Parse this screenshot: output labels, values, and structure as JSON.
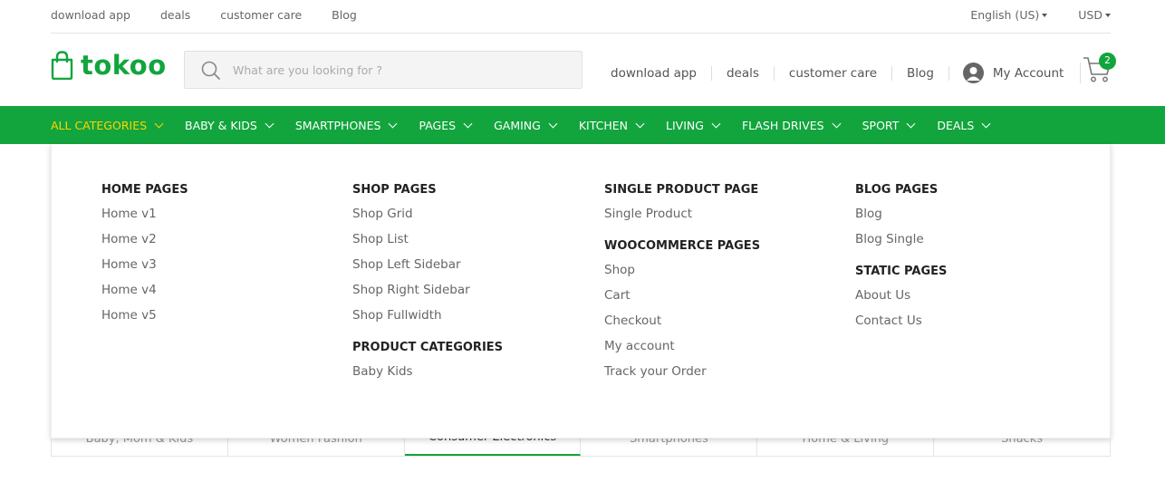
{
  "topbar": {
    "links": [
      "download app",
      "deals",
      "customer care",
      "Blog"
    ],
    "language": "English (US)",
    "currency": "USD"
  },
  "header": {
    "logo_text": "tokoo",
    "search_placeholder": "What are you looking for ?",
    "links": [
      "download app",
      "deals",
      "customer care",
      "Blog"
    ],
    "account_label": "My Account",
    "cart_count": "2"
  },
  "nav": {
    "items": [
      {
        "label": "ALL CATEGORIES",
        "active": true
      },
      {
        "label": "BABY & KIDS"
      },
      {
        "label": "SMARTPHONES"
      },
      {
        "label": "PAGES"
      },
      {
        "label": "GAMING"
      },
      {
        "label": "KITCHEN"
      },
      {
        "label": "LIVING"
      },
      {
        "label": "FLASH DRIVES"
      },
      {
        "label": "SPORT"
      },
      {
        "label": "DEALS"
      }
    ]
  },
  "mega": {
    "col1": {
      "title": "HOME PAGES",
      "items": [
        "Home v1",
        "Home v2",
        "Home v3",
        "Home v4",
        "Home v5"
      ]
    },
    "col2": {
      "title": "SHOP PAGES",
      "items": [
        "Shop Grid",
        "Shop List",
        "Shop Left Sidebar",
        "Shop Right Sidebar",
        "Shop Fullwidth"
      ],
      "title2": "PRODUCT CATEGORIES",
      "items2": [
        "Baby Kids"
      ]
    },
    "col3": {
      "title": "SINGLE PRODUCT PAGE",
      "items": [
        "Single Product"
      ],
      "title2": "WOOCOMMERCE PAGES",
      "items2": [
        "Shop",
        "Cart",
        "Checkout",
        "My account",
        "Track your Order"
      ]
    },
    "col4": {
      "title": "BLOG PAGES",
      "items": [
        "Blog",
        "Blog Single"
      ],
      "title2": "STATIC PAGES",
      "items2": [
        "About Us",
        "Contact Us"
      ]
    }
  },
  "tabs": [
    "Baby, Mom & Kids",
    "Women Fashion",
    "Consumer Electronics",
    "Smartphones",
    "Home & Living",
    "Snacks"
  ],
  "colors": {
    "brand_green": "#12a53d",
    "active_yellow": "#ffd400"
  }
}
